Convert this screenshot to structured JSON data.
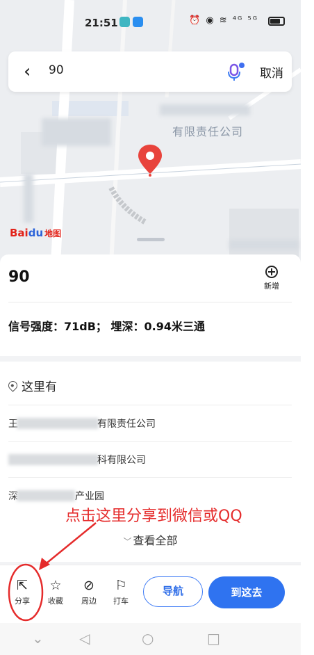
{
  "status_bar": {
    "time": "21:51",
    "system_icons": "⏰ ◉ ≋ ⁴ᴳ ⁵ᴳ"
  },
  "search": {
    "query": "90",
    "cancel_label": "取消"
  },
  "map": {
    "company_label": "有限责任公司",
    "logo_bai": "Bai",
    "logo_du": "du",
    "logo_map": "地图"
  },
  "place": {
    "title": "90",
    "add_label": "新增",
    "description": "信号强度：71dB； 埋深：0.94米三通"
  },
  "here_section": {
    "title": "这里有",
    "items": [
      {
        "prefix": "王",
        "suffix": "有限责任公司"
      },
      {
        "prefix": "",
        "suffix": "科有限公司"
      },
      {
        "prefix": "深",
        "suffix": "产业园"
      }
    ],
    "view_all_label": "查看全部"
  },
  "annotation": "点击这里分享到微信或QQ",
  "actions": {
    "share_label": "分享",
    "favorite_label": "收藏",
    "nearby_label": "周边",
    "taxi_label": "打车",
    "navigate_label": "导航",
    "go_here_label": "到这去"
  },
  "colors": {
    "primary": "#2f73f0",
    "annotation": "#e52b2b",
    "pin": "#e8433c"
  }
}
